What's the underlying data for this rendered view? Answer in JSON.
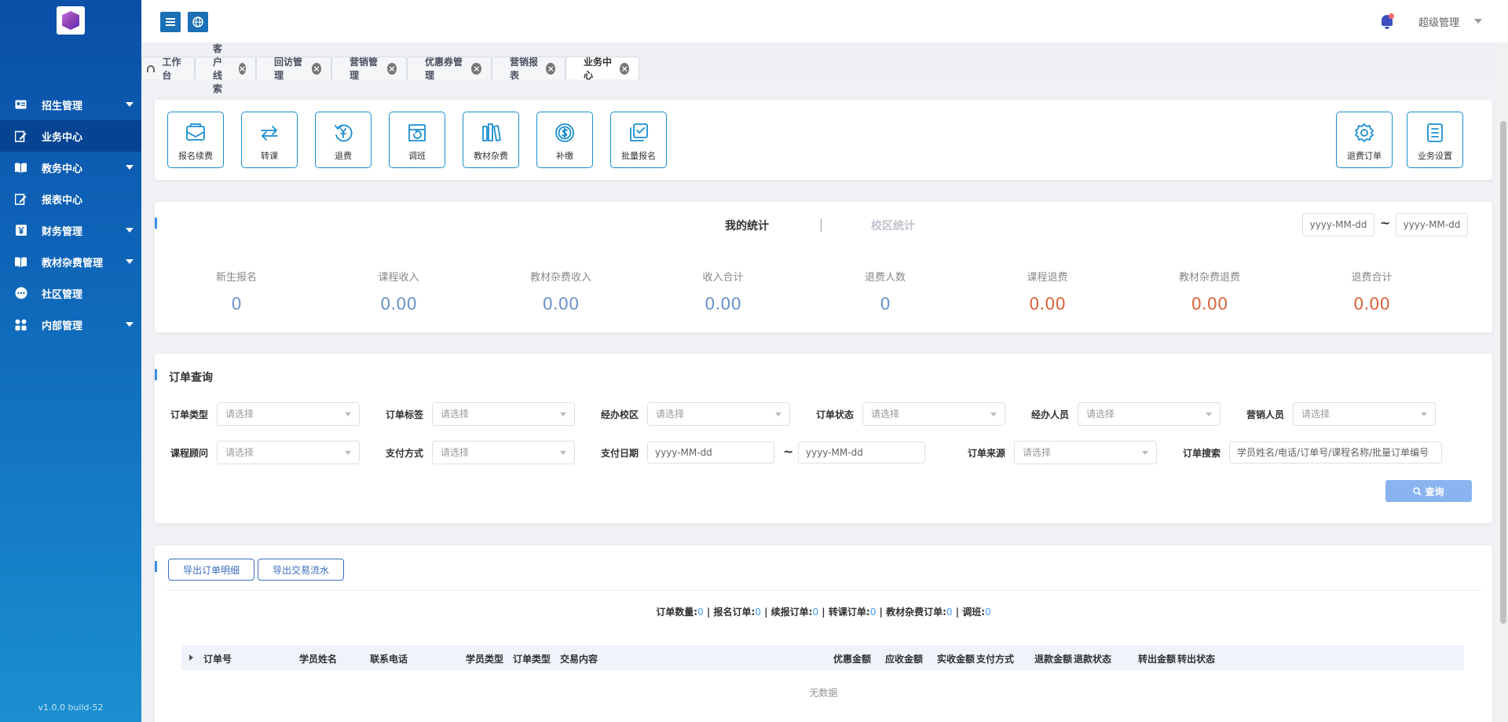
{
  "sidebar": {
    "version": "v1.0.0 build-52",
    "items": [
      {
        "label": "招生管理",
        "icon": "id-card-icon",
        "has_submenu": true,
        "active": false
      },
      {
        "label": "业务中心",
        "icon": "edit-icon",
        "has_submenu": false,
        "active": true
      },
      {
        "label": "教务中心",
        "icon": "book-icon",
        "has_submenu": true,
        "active": false
      },
      {
        "label": "报表中心",
        "icon": "edit-icon",
        "has_submenu": false,
        "active": false
      },
      {
        "label": "财务管理",
        "icon": "yen-icon",
        "has_submenu": true,
        "active": false
      },
      {
        "label": "教材杂费管理",
        "icon": "book-icon",
        "has_submenu": true,
        "active": false
      },
      {
        "label": "社区管理",
        "icon": "chat-icon",
        "has_submenu": false,
        "active": false
      },
      {
        "label": "内部管理",
        "icon": "grid-icon",
        "has_submenu": true,
        "active": false
      }
    ]
  },
  "topbar": {
    "user": "超级管理"
  },
  "tabs": [
    {
      "label": "工作台",
      "closable": false,
      "active": false
    },
    {
      "label": "客户线索",
      "closable": true,
      "active": false
    },
    {
      "label": "回访管理",
      "closable": true,
      "active": false
    },
    {
      "label": "营销管理",
      "closable": true,
      "active": false
    },
    {
      "label": "优惠券管理",
      "closable": true,
      "active": false
    },
    {
      "label": "营销报表",
      "closable": true,
      "active": false
    },
    {
      "label": "业务中心",
      "closable": true,
      "active": true
    }
  ],
  "quick_actions": [
    {
      "label": "报名续费",
      "icon": "envelope-icon"
    },
    {
      "label": "转课",
      "icon": "swap-icon"
    },
    {
      "label": "退费",
      "icon": "refund-icon"
    },
    {
      "label": "调班",
      "icon": "adjust-class-icon"
    },
    {
      "label": "教材杂费",
      "icon": "books-icon"
    },
    {
      "label": "补缴",
      "icon": "coin-icon"
    },
    {
      "label": "批量报名",
      "icon": "batch-check-icon"
    }
  ],
  "quick_actions_right": [
    {
      "label": "退费订单",
      "icon": "gear-icon"
    },
    {
      "label": "业务设置",
      "icon": "list-doc-icon"
    }
  ],
  "stats": {
    "tab_mine": "我的统计",
    "tab_campus": "校区统计",
    "date_from_placeholder": "yyyy-MM-dd",
    "date_to_placeholder": "yyyy-MM-dd",
    "tilde": "~",
    "columns": [
      {
        "label": "新生报名",
        "value": "0",
        "color": "#6b93c9"
      },
      {
        "label": "课程收入",
        "value": "0.00",
        "color": "#6b93c9"
      },
      {
        "label": "教材杂费收入",
        "value": "0.00",
        "color": "#6b93c9"
      },
      {
        "label": "收入合计",
        "value": "0.00",
        "color": "#6b93c9"
      },
      {
        "label": "退费人数",
        "value": "0",
        "color": "#6b93c9"
      },
      {
        "label": "课程退费",
        "value": "0.00",
        "color": "#d9663b"
      },
      {
        "label": "教材杂费退费",
        "value": "0.00",
        "color": "#d9663b"
      },
      {
        "label": "退费合计",
        "value": "0.00",
        "color": "#d9663b"
      }
    ]
  },
  "order_query": {
    "title": "订单查询",
    "select_placeholder": "请选择",
    "date_placeholder": "yyyy-MM-dd",
    "tilde": "~",
    "fields": {
      "order_type": "订单类型",
      "order_tag": "订单标签",
      "campus": "经办校区",
      "order_status": "订单状态",
      "handler": "经办人员",
      "marketer": "营销人员",
      "advisor": "课程顾问",
      "pay_method": "支付方式",
      "pay_date": "支付日期",
      "order_source": "订单来源",
      "order_search": "订单搜索"
    },
    "search_placeholder": "学员姓名/电话/订单号/课程名称/批量订单编号",
    "search_button": "查询"
  },
  "orders": {
    "export_detail": "导出订单明细",
    "export_flow": "导出交易流水",
    "summary": [
      {
        "label": "订单数量:",
        "count": "0"
      },
      {
        "label": "报名订单:",
        "count": "0"
      },
      {
        "label": "续报订单:",
        "count": "0"
      },
      {
        "label": "转课订单:",
        "count": "0"
      },
      {
        "label": "教材杂费订单:",
        "count": "0"
      },
      {
        "label": "调班:",
        "count": "0"
      }
    ],
    "columns": [
      "订单号",
      "学员姓名",
      "联系电话",
      "学员类型",
      "订单类型",
      "交易内容",
      "优惠金额",
      "应收金额",
      "实收金额",
      "支付方式",
      "退款金额",
      "退款状态",
      "转出金额",
      "转出状态"
    ],
    "empty_text": "无数据"
  }
}
